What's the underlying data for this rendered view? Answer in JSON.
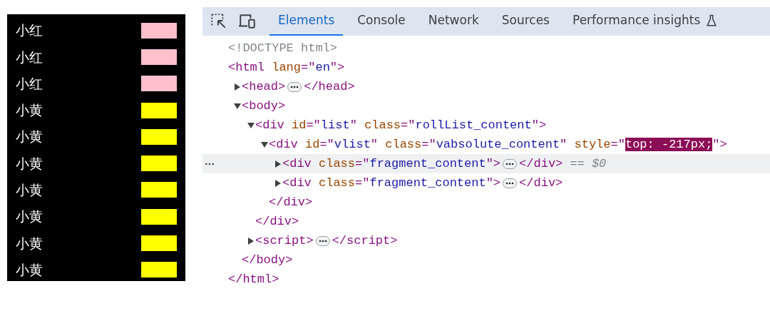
{
  "preview_list": {
    "items": [
      {
        "name": "小红",
        "color": "#ffc0cb"
      },
      {
        "name": "小红",
        "color": "#ffc0cb"
      },
      {
        "name": "小红",
        "color": "#ffc0cb"
      },
      {
        "name": "小黄",
        "color": "#ffff00"
      },
      {
        "name": "小黄",
        "color": "#ffff00"
      },
      {
        "name": "小黄",
        "color": "#ffff00"
      },
      {
        "name": "小黄",
        "color": "#ffff00"
      },
      {
        "name": "小黄",
        "color": "#ffff00"
      },
      {
        "name": "小黄",
        "color": "#ffff00"
      },
      {
        "name": "小黄",
        "color": "#ffff00"
      }
    ]
  },
  "devtools": {
    "tabs": [
      {
        "label": "Elements",
        "selected": true,
        "experimental": false
      },
      {
        "label": "Console",
        "selected": false,
        "experimental": false
      },
      {
        "label": "Network",
        "selected": false,
        "experimental": false
      },
      {
        "label": "Sources",
        "selected": false,
        "experimental": false
      },
      {
        "label": "Performance insights",
        "selected": false,
        "experimental": true
      }
    ],
    "dom_tree": [
      {
        "open": [
          {
            "kind": "doctype",
            "text": "<!DOCTYPE html>"
          }
        ]
      },
      {
        "open": [
          {
            "kind": "tag",
            "text": "<html"
          },
          {
            "kind": "attr",
            "text": " lang"
          },
          {
            "kind": "tag",
            "text": "=\""
          },
          {
            "kind": "value",
            "text": "en"
          },
          {
            "kind": "tag",
            "text": "\">"
          }
        ],
        "close": [
          {
            "kind": "tag",
            "text": "</html>"
          }
        ],
        "children": [
          {
            "open": [
              {
                "kind": "tag",
                "text": "<head>"
              }
            ],
            "expanded": false,
            "close": [
              {
                "kind": "tag",
                "text": "</head>"
              }
            ]
          },
          {
            "open": [
              {
                "kind": "tag",
                "text": "<body>"
              }
            ],
            "expanded": true,
            "close": [
              {
                "kind": "tag",
                "text": "</body>"
              }
            ],
            "children": [
              {
                "open": [
                  {
                    "kind": "tag",
                    "text": "<div"
                  },
                  {
                    "kind": "attr",
                    "text": " id"
                  },
                  {
                    "kind": "tag",
                    "text": "=\""
                  },
                  {
                    "kind": "value",
                    "text": "list"
                  },
                  {
                    "kind": "tag",
                    "text": "\""
                  },
                  {
                    "kind": "attr",
                    "text": " class"
                  },
                  {
                    "kind": "tag",
                    "text": "=\""
                  },
                  {
                    "kind": "value",
                    "text": "rollList_content"
                  },
                  {
                    "kind": "tag",
                    "text": "\">"
                  }
                ],
                "expanded": true,
                "close": [
                  {
                    "kind": "tag",
                    "text": "</div>"
                  }
                ],
                "children": [
                  {
                    "open": [
                      {
                        "kind": "tag",
                        "text": "<div"
                      },
                      {
                        "kind": "attr",
                        "text": " id"
                      },
                      {
                        "kind": "tag",
                        "text": "=\""
                      },
                      {
                        "kind": "value",
                        "text": "vlist"
                      },
                      {
                        "kind": "tag",
                        "text": "\""
                      },
                      {
                        "kind": "attr",
                        "text": " class"
                      },
                      {
                        "kind": "tag",
                        "text": "=\""
                      },
                      {
                        "kind": "value",
                        "text": "vabsolute_content"
                      },
                      {
                        "kind": "tag",
                        "text": "\""
                      },
                      {
                        "kind": "attr",
                        "text": " style"
                      },
                      {
                        "kind": "tag",
                        "text": "=\""
                      },
                      {
                        "kind": "highlight",
                        "text": "top: -217px;"
                      },
                      {
                        "kind": "tag",
                        "text": "\">"
                      }
                    ],
                    "expanded": true,
                    "close": [
                      {
                        "kind": "tag",
                        "text": "</div>"
                      }
                    ],
                    "children": [
                      {
                        "open": [
                          {
                            "kind": "tag",
                            "text": "<div"
                          },
                          {
                            "kind": "attr",
                            "text": " class"
                          },
                          {
                            "kind": "tag",
                            "text": "=\""
                          },
                          {
                            "kind": "value",
                            "text": "fragment_content"
                          },
                          {
                            "kind": "tag",
                            "text": "\">"
                          }
                        ],
                        "expanded": false,
                        "selected": true,
                        "note": "== $0",
                        "close": [
                          {
                            "kind": "tag",
                            "text": "</div>"
                          }
                        ]
                      },
                      {
                        "open": [
                          {
                            "kind": "tag",
                            "text": "<div"
                          },
                          {
                            "kind": "attr",
                            "text": " class"
                          },
                          {
                            "kind": "tag",
                            "text": "=\""
                          },
                          {
                            "kind": "value",
                            "text": "fragment_content"
                          },
                          {
                            "kind": "tag",
                            "text": "\">"
                          }
                        ],
                        "expanded": false,
                        "selected": false,
                        "close": [
                          {
                            "kind": "tag",
                            "text": "</div>"
                          }
                        ]
                      }
                    ]
                  }
                ]
              },
              {
                "open": [
                  {
                    "kind": "tag",
                    "text": "<script>"
                  }
                ],
                "expanded": false,
                "close": [
                  {
                    "kind": "tag",
                    "text": "</script>"
                  }
                ]
              }
            ]
          }
        ]
      }
    ]
  }
}
